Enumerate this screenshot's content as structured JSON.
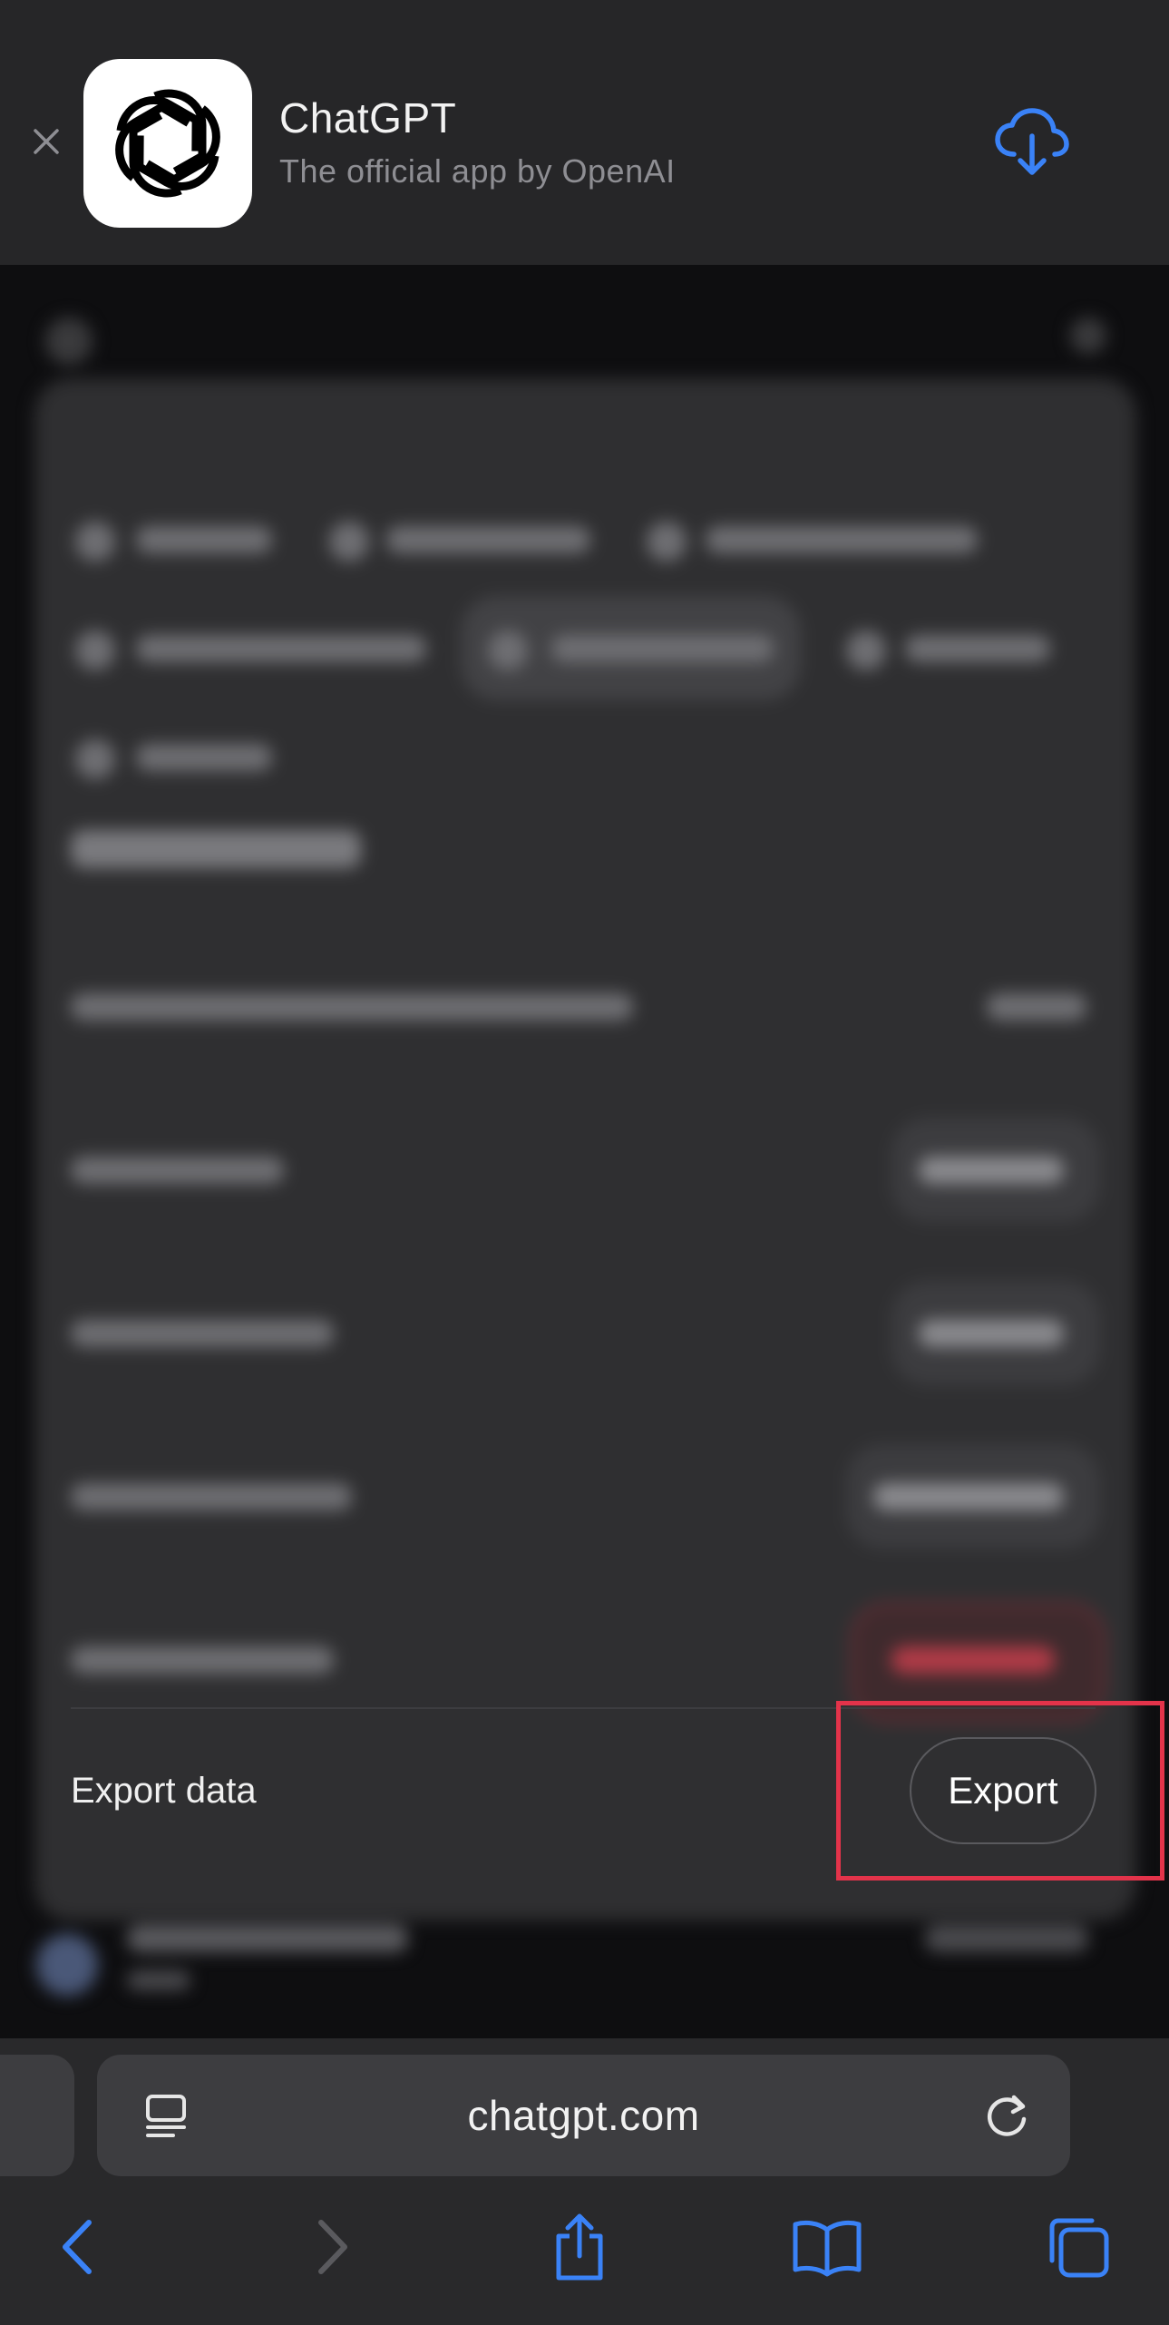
{
  "banner": {
    "app_name": "ChatGPT",
    "app_subtitle": "The official app by OpenAI",
    "icons": {
      "close": "close-icon",
      "app": "openai-logo-icon",
      "download": "cloud-download-icon"
    },
    "accent_color": "#3a82f7"
  },
  "settings": {
    "export_row": {
      "label": "Export data",
      "button_label": "Export"
    },
    "highlight_color": "#e3334a"
  },
  "safari": {
    "url": "chatgpt.com",
    "icons": {
      "reader": "reader-mode-icon",
      "reload": "reload-icon",
      "back": "chevron-left-icon",
      "forward": "chevron-right-icon",
      "share": "share-icon",
      "bookmarks": "book-icon",
      "tabs": "tabs-icon"
    }
  }
}
